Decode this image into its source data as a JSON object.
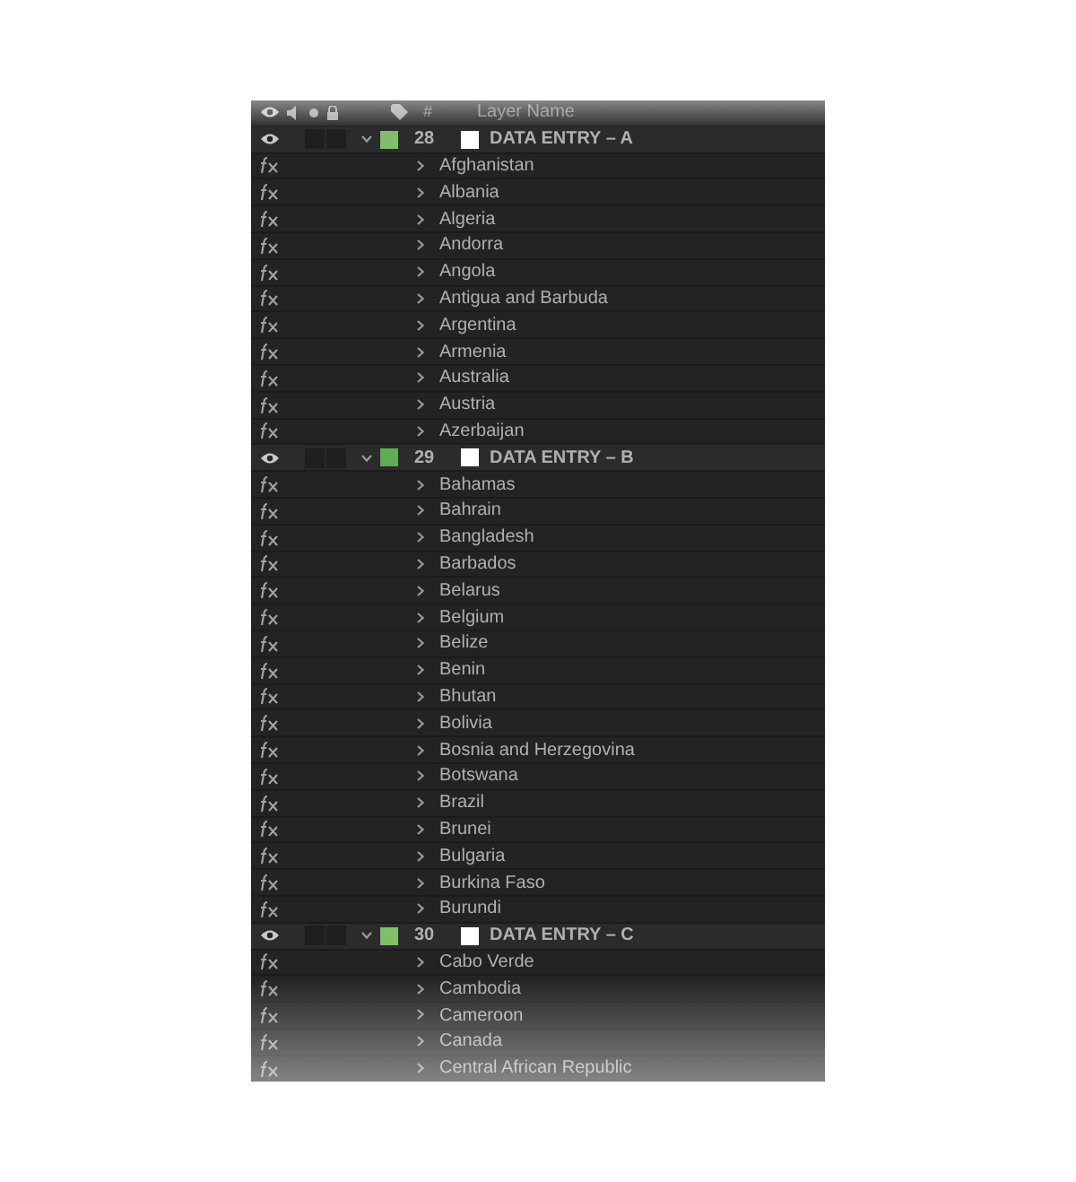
{
  "header": {
    "number_label": "#",
    "name_label": "Layer Name"
  },
  "layers": [
    {
      "number": "28",
      "name": "DATA ENTRY – A",
      "color": "#7fbf6a",
      "expanded": true,
      "effects": [
        "Afghanistan",
        "Albania",
        "Algeria",
        "Andorra",
        "Angola",
        "Antigua and Barbuda",
        "Argentina",
        "Armenia",
        "Australia",
        "Austria",
        "Azerbaijan"
      ]
    },
    {
      "number": "29",
      "name": "DATA ENTRY – B",
      "color": "#5fae55",
      "expanded": true,
      "effects": [
        "Bahamas",
        "Bahrain",
        "Bangladesh",
        "Barbados",
        "Belarus",
        "Belgium",
        "Belize",
        "Benin",
        "Bhutan",
        "Bolivia",
        "Bosnia and Herzegovina",
        "Botswana",
        "Brazil",
        "Brunei",
        "Bulgaria",
        "Burkina Faso",
        "Burundi"
      ]
    },
    {
      "number": "30",
      "name": "DATA ENTRY – C",
      "color": "#7fbf6a",
      "expanded": true,
      "effects": [
        "Cabo Verde",
        "Cambodia",
        "Cameroon",
        "Canada",
        "Central African Republic"
      ]
    }
  ]
}
